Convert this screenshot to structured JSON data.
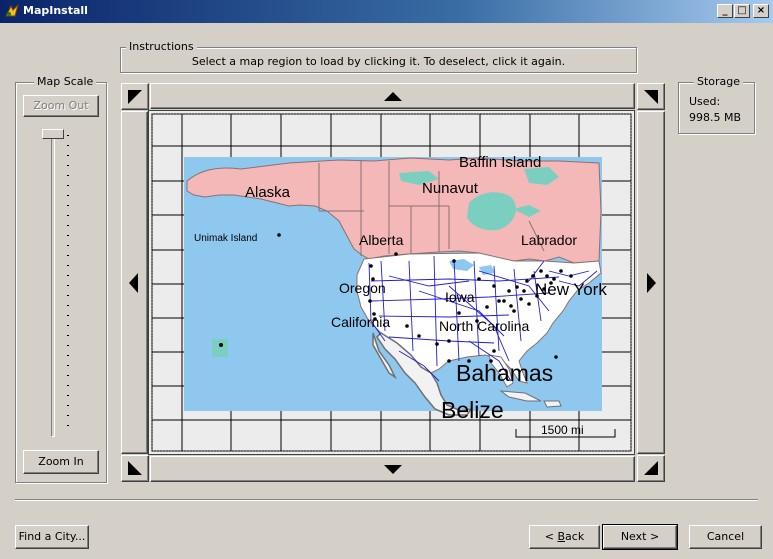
{
  "window": {
    "title": "MapInstall",
    "controls": {
      "minimize": "_",
      "maximize": "□",
      "close": "×"
    }
  },
  "instructions": {
    "label": "Instructions",
    "text": "Select a map region to load by clicking it. To deselect, click it again."
  },
  "map_scale": {
    "label": "Map Scale",
    "zoom_out": "Zoom Out",
    "zoom_in": "Zoom In",
    "slider_level": 0.0
  },
  "storage": {
    "label": "Storage",
    "used_label": "Used:",
    "used_value": "998.5 MB"
  },
  "map": {
    "labels": {
      "baffin": "Baffin Island",
      "alaska": "Alaska",
      "nunavut": "Nunavut",
      "unimak": "Unimak Island",
      "alberta": "Alberta",
      "labrador": "Labrador",
      "oregon": "Oregon",
      "iowa": "Iowa",
      "new_york": "New York",
      "california": "California",
      "north_carolina": "North Carolina",
      "bahamas": "Bahamas",
      "belize": "Belize"
    },
    "scale_bar": "1500 mi",
    "colors": {
      "ocean": "#8ec8ef",
      "canada_alaska": "#f5b8b8",
      "land": "#ffffff",
      "highways": "#2020d0",
      "borders": "#7a6a6a",
      "water_inland": "#7bcfc0"
    }
  },
  "footer": {
    "find_city": "Find a City...",
    "back": "Back",
    "back_mnemonic": "B",
    "next": "Next >",
    "cancel": "Cancel"
  }
}
